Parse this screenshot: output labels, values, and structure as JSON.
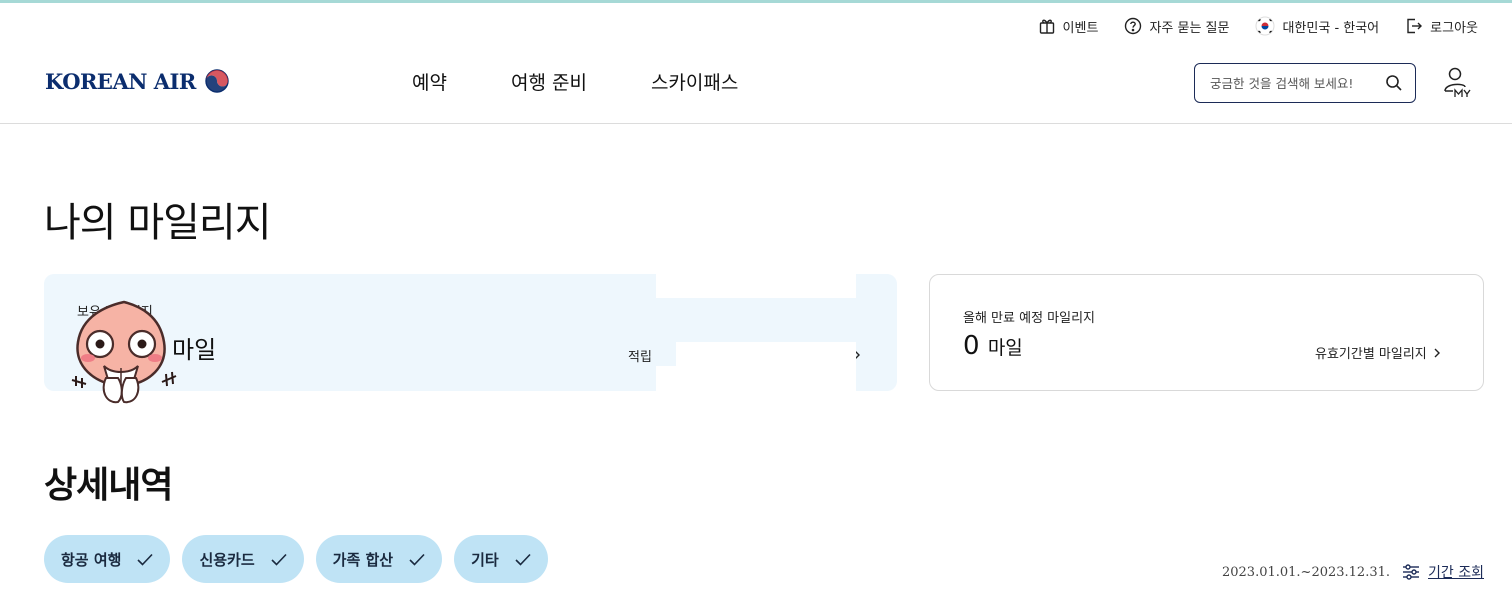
{
  "utility": {
    "event": "이벤트",
    "faq": "자주 묻는 질문",
    "language": "대한민국 - 한국어",
    "logout": "로그아웃"
  },
  "header": {
    "logo": "KOREAN AIR",
    "nav": [
      "예약",
      "여행 준비",
      "스카이패스"
    ],
    "search_placeholder": "궁금한 것을 검색해 보세요!"
  },
  "page": {
    "title": "나의 마일리지",
    "balance_card": {
      "label": "보유 마일리지",
      "unit": "마일",
      "earn_link": "적립"
    },
    "expire_card": {
      "label": "올해 만료 예정 마일리지",
      "value": "0",
      "unit": "마일",
      "link": "유효기간별 마일리지"
    },
    "details": {
      "title": "상세내역",
      "filters": [
        "항공 여행",
        "신용카드",
        "가족 합산",
        "기타"
      ],
      "period": "2023.01.01.~2023.12.31.",
      "period_button": "기간 조회"
    }
  },
  "colors": {
    "brand_navy": "#0b2d6e",
    "card_bg": "#eef7fd",
    "chip_bg": "#bfe3f5"
  },
  "icons": {
    "event": "gift-icon",
    "faq": "question-icon",
    "language": "korea-flag-icon",
    "logout": "logout-icon",
    "search": "search-icon",
    "my": "my-user-icon",
    "chip": "check-icon",
    "period": "filter-sliders-icon"
  }
}
